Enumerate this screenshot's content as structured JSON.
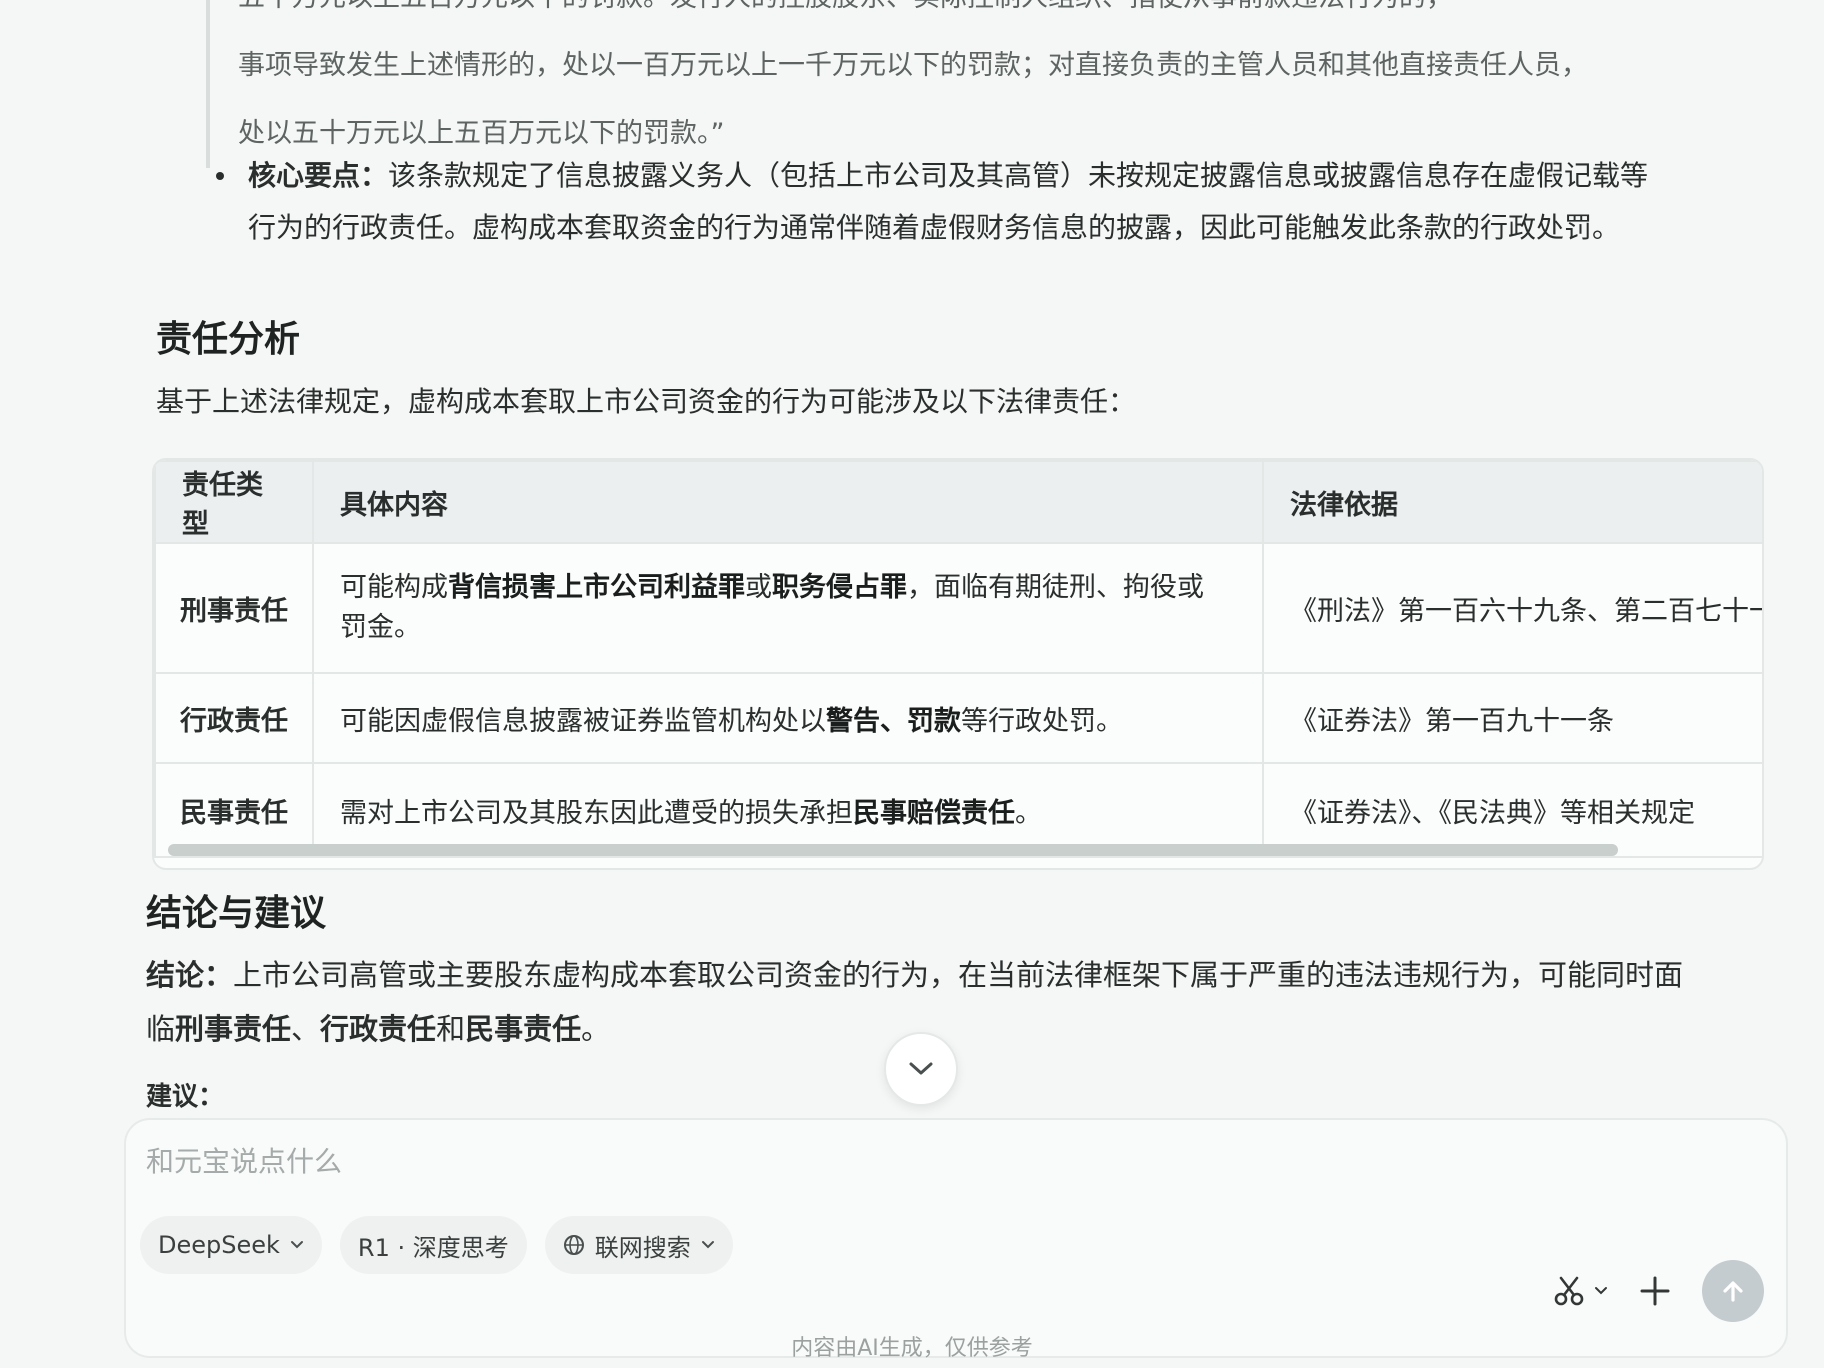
{
  "quote": {
    "lines": [
      "五十万元以上五百万元以下的罚款。发行人的控股股东、实际控制人组织、指使从事前款违法行为的，",
      "事项导致发生上述情形的，处以一百万元以上一千万元以下的罚款；对直接负责的主管人员和其他直接责任人员，",
      "处以五十万元以上五百万元以下的罚款。”"
    ]
  },
  "core_point": {
    "label": "核心要点：",
    "line1": "该条款规定了信息披露义务人（包括上市公司及其高管）未按规定披露信息或披露信息存在虚假记载等",
    "line2": "行为的行政责任。虚构成本套取资金的行为通常伴随着虚假财务信息的披露，因此可能触发此条款的行政处罚。"
  },
  "section1": {
    "title": "责任分析",
    "desc": "基于上述法律规定，虚构成本套取上市公司资金的行为可能涉及以下法律责任："
  },
  "table": {
    "headers": [
      "责任类型",
      "具体内容",
      "法律依据"
    ],
    "rows": [
      {
        "type": "刑事责任",
        "c1": "可能构成",
        "b1": "背信损害上市公司利益罪",
        "c2": "或",
        "b2": "职务侵占罪",
        "c3": "，面临有期徒刑、拘役或",
        "c4": "罚金。",
        "basis": "《刑法》第一百六十九条、第二百七十一条"
      },
      {
        "type": "行政责任",
        "c1": "可能因虚假信息披露被证券监管机构处以",
        "b1": "警告、罚款",
        "c2": "等行政处罚。",
        "basis": "《证券法》第一百九十一条"
      },
      {
        "type": "民事责任",
        "c1": "需对上市公司及其股东因此遭受的损失承担",
        "b1": "民事赔偿责任",
        "c2": "。",
        "basis": "《证券法》、《民法典》等相关规定"
      }
    ]
  },
  "section2": {
    "title": "结论与建议",
    "conclusion_label": "结论：",
    "conclusion_line1": "上市公司高管或主要股东虚构成本套取公司资金的行为，在当前法律框架下属于严重的违法违规行为，可能同时面",
    "conclusion_line2_prefix": "临",
    "conclusion_b1": "刑事责任",
    "conclusion_sep1": "、",
    "conclusion_b2": "行政责任",
    "conclusion_sep2": "和",
    "conclusion_b3": "民事责任",
    "conclusion_end": "。",
    "advice_label": "建议："
  },
  "composer": {
    "placeholder": "和元宝说点什么",
    "model_chip": "DeepSeek",
    "think_chip": "R1 · 深度思考",
    "search_chip": "联网搜索"
  },
  "disclaimer": "内容由AI生成，仅供参考",
  "icons": {
    "scroll": "chevron-down-icon",
    "scissors": "scissors-icon",
    "plus": "plus-icon",
    "send": "send-arrow-icon",
    "globe": "globe-icon"
  }
}
